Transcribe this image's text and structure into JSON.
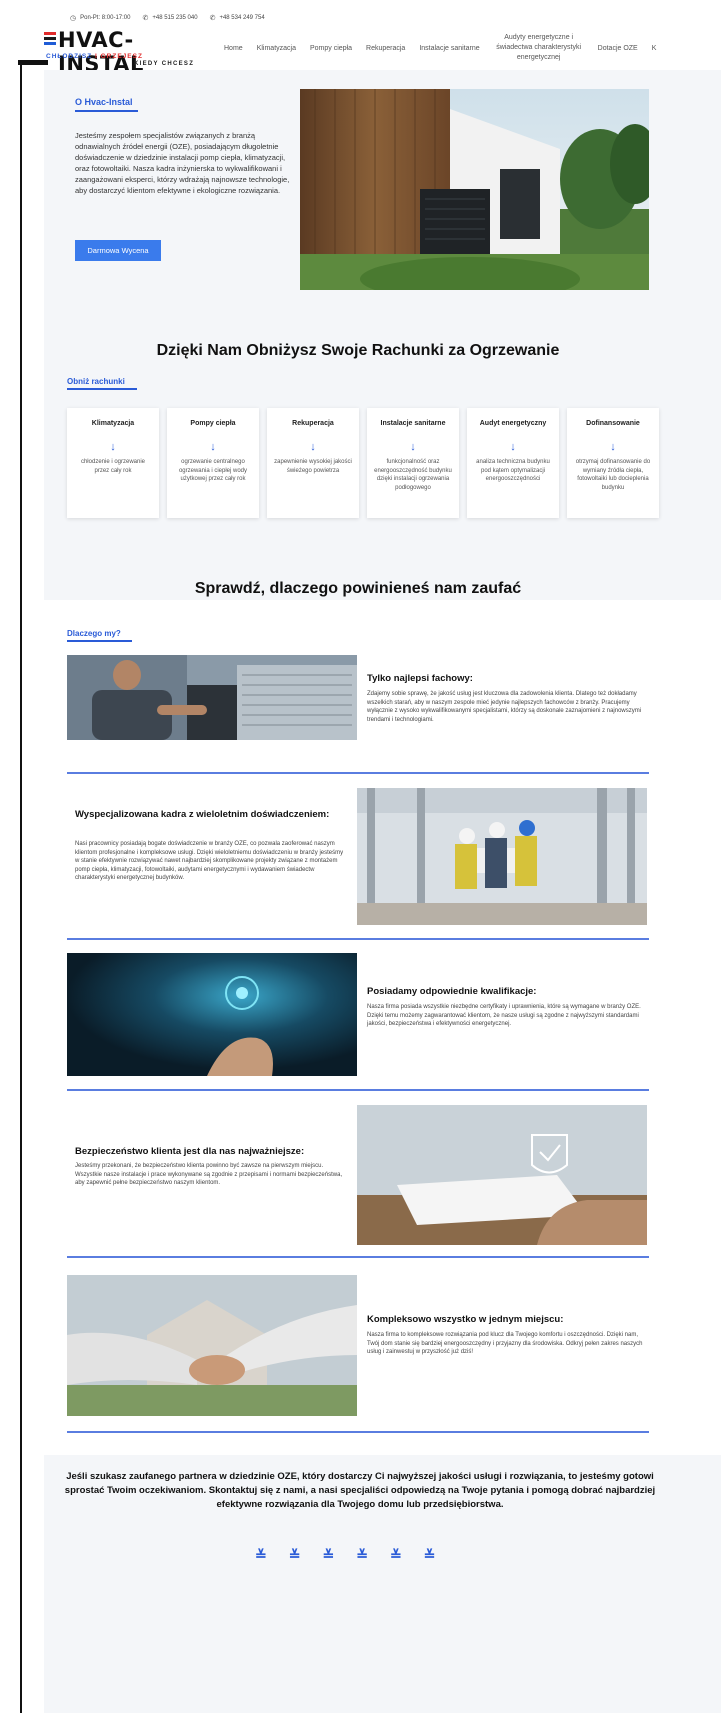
{
  "topbar": {
    "hours": "Pon-Pt: 8:00-17:00",
    "phone1": "+48 515 235 040",
    "phone2": "+48 534 249 754"
  },
  "logo": {
    "brand": "HVAC-INSTAL",
    "tagline_left": "CHŁODZISZ",
    "tagline_sep": " I ",
    "tagline_right": "GRZEJESZ",
    "tagline_bottom": "KIEDY CHCESZ"
  },
  "nav": {
    "items": [
      "Home",
      "Klimatyzacja",
      "Pompy ciepła",
      "Rekuperacja",
      "Instalacje sanitarne",
      "Audyty energetyczne i świadectwa charakterystyki energetycznej",
      "Dotacje OZE",
      "K"
    ]
  },
  "about": {
    "title": "O Hvac-Instal",
    "text": "Jesteśmy zespołem specjalistów związanych z branżą odnawialnych źródeł energii (OZE), posiadającym długoletnie doświadczenie w dziedzinie instalacji pomp ciepła, klimatyzacji, oraz fotowoltaiki. Nasza kadra inżynierska to wykwalifikowani i zaangażowani eksperci, którzy wdrażają najnowsze technologie, aby dostarczyć klientom efektywne i ekologiczne rozwiązania.",
    "cta": "Darmowa Wycena"
  },
  "savings": {
    "heading": "Dzięki Nam Obniżysz Swoje Rachunki za Ogrzewanie",
    "label": "Obniż rachunki",
    "cards": [
      {
        "title": "Klimatyzacja",
        "desc": "chłodzenie i ogrzewanie przez cały rok"
      },
      {
        "title": "Pompy ciepła",
        "desc": "ogrzewanie centralnego ogrzewania i ciepłej wody użytkowej przez cały rok"
      },
      {
        "title": "Rekuperacja",
        "desc": "zapewnienie wysokiej jakości świeżego powietrza"
      },
      {
        "title": "Instalacje sanitarne",
        "desc": "funkcjonalność oraz energooszczędność budynku dzięki instalacji ogrzewania podłogowego"
      },
      {
        "title": "Audyt energetyczny",
        "desc": "analiza techniczna budynku pod kątem optymalizacji energooszczędności"
      },
      {
        "title": "Dofinansowanie",
        "desc": "otrzymaj dofinansowanie do wymiany źródła ciepła, fotowoltaiki lub docieplenia budynku"
      }
    ]
  },
  "why": {
    "heading": "Sprawdź, dlaczego powinieneś nam zaufać",
    "label": "Dlaczego my?",
    "blocks": [
      {
        "title": "Tylko najlepsi fachowy:",
        "text": "Zdajemy sobie sprawę, że jakość usług jest kluczowa dla zadowolenia klienta. Dlatego też dokładamy wszelkich starań, aby w naszym zespole mieć jedynie najlepszych fachowców z branży. Pracujemy wyłącznie z wysoko wykwalifikowanymi specjalistami, którzy są doskonale zaznajomieni z najnowszymi trendami i technologiami."
      },
      {
        "title": "Wyspecjalizowana kadra z wieloletnim doświadczeniem:",
        "text": "Nasi pracownicy posiadają bogate doświadczenie w branży OZE, co pozwala zaoferować naszym klientom profesjonalne i kompleksowe usługi. Dzięki wieloletniemu doświadczeniu w branży jesteśmy w stanie efektywnie rozwiązywać nawet najbardziej skomplikowane projekty związane z montażem pomp ciepła, klimatyzacji, fotowoltaiki, audytami energetycznymi i wydawaniem świadectw charakterystyki energetycznej budynków."
      },
      {
        "title": "Posiadamy odpowiednie kwalifikacje:",
        "text": "Nasza firma posiada wszystkie niezbędne certyfikaty i uprawnienia, które są wymagane w branży OZE. Dzięki temu możemy zagwarantować klientom, że nasze usługi są zgodne z najwyższymi standardami jakości, bezpieczeństwa i efektywności energetycznej."
      },
      {
        "title": "Bezpieczeństwo klienta jest dla nas najważniejsze:",
        "text": "Jesteśmy przekonani, że bezpieczeństwo klienta powinno być zawsze na pierwszym miejscu. Wszystkie nasze instalacje i prace wykonywane są zgodnie z przepisami i normami bezpieczeństwa, aby zapewnić pełne bezpieczeństwo naszym klientom."
      },
      {
        "title": "Kompleksowo wszystko w jednym miejscu:",
        "text": "Nasza firma to kompleksowe rozwiązania pod klucz dla Twojego komfortu i oszczędności. Dzięki nam, Twój dom stanie się bardziej energooszczędny i przyjazny dla środowiska. Odkryj pełen zakres naszych usług i zainwestuj w przyszłość już dziś!"
      }
    ]
  },
  "final": {
    "text": "Jeśli szukasz zaufanego partnera w dziedzinie OZE, który dostarczy Ci najwyższej jakości usługi i rozwiązania, to jesteśmy gotowi sprostać Twoim oczekiwaniom. Skontaktuj się z nami, a nasi specjaliści odpowiedzą na Twoje pytania i pomogą dobrać najbardziej efektywne rozwiązania dla Twojego domu lub przedsiębiorstwa."
  },
  "colors": {
    "accent": "#2a5bd7",
    "cta": "#3a7bec",
    "logo_red": "#e02b2b",
    "section_bg": "#f4f6f9",
    "divider": "#5a7de0"
  }
}
